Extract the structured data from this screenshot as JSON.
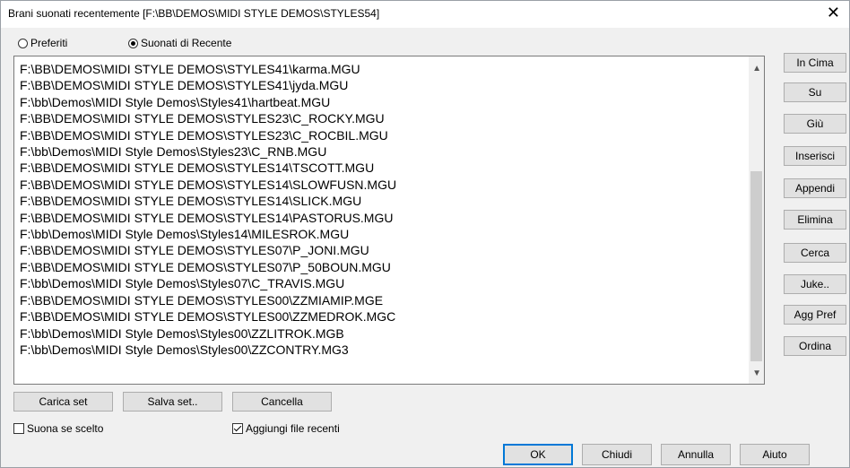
{
  "window": {
    "title": "Brani suonati recentemente   [F:\\BB\\DEMOS\\MIDI STYLE DEMOS\\STYLES54]",
    "close_glyph": "✕"
  },
  "radios": {
    "preferiti": "Preferiti",
    "suonati": "Suonati di Recente",
    "selected": "suonati"
  },
  "list": {
    "items": [
      "F:\\BB\\DEMOS\\MIDI STYLE DEMOS\\STYLES41\\karma.MGU",
      "F:\\BB\\DEMOS\\MIDI STYLE DEMOS\\STYLES41\\jyda.MGU",
      "F:\\bb\\Demos\\MIDI Style Demos\\Styles41\\hartbeat.MGU",
      "F:\\BB\\DEMOS\\MIDI STYLE DEMOS\\STYLES23\\C_ROCKY.MGU",
      "F:\\BB\\DEMOS\\MIDI STYLE DEMOS\\STYLES23\\C_ROCBIL.MGU",
      "F:\\bb\\Demos\\MIDI Style Demos\\Styles23\\C_RNB.MGU",
      "F:\\BB\\DEMOS\\MIDI STYLE DEMOS\\STYLES14\\TSCOTT.MGU",
      "F:\\BB\\DEMOS\\MIDI STYLE DEMOS\\STYLES14\\SLOWFUSN.MGU",
      "F:\\BB\\DEMOS\\MIDI STYLE DEMOS\\STYLES14\\SLICK.MGU",
      "F:\\BB\\DEMOS\\MIDI STYLE DEMOS\\STYLES14\\PASTORUS.MGU",
      "F:\\bb\\Demos\\MIDI Style Demos\\Styles14\\MILESROK.MGU",
      "F:\\BB\\DEMOS\\MIDI STYLE DEMOS\\STYLES07\\P_JONI.MGU",
      "F:\\BB\\DEMOS\\MIDI STYLE DEMOS\\STYLES07\\P_50BOUN.MGU",
      "F:\\bb\\Demos\\MIDI Style Demos\\Styles07\\C_TRAVIS.MGU",
      "F:\\BB\\DEMOS\\MIDI STYLE DEMOS\\STYLES00\\ZZMIAMIP.MGE",
      "F:\\BB\\DEMOS\\MIDI STYLE DEMOS\\STYLES00\\ZZMEDROK.MGC",
      "F:\\bb\\Demos\\MIDI Style Demos\\Styles00\\ZZLITROK.MGB",
      "F:\\bb\\Demos\\MIDI Style Demos\\Styles00\\ZZCONTRY.MG3"
    ]
  },
  "side_buttons": [
    "In Cima",
    "Su",
    "Giù",
    "Inserisci",
    "Appendi",
    "Elimina",
    "Cerca",
    "Juke..",
    "Agg Pref",
    "Ordina"
  ],
  "bottom_buttons": {
    "carica": "Carica set",
    "salva": "Salva set..",
    "cancella": "Cancella"
  },
  "checkboxes": {
    "suona": {
      "label": "Suona se scelto",
      "checked": false
    },
    "aggiungi": {
      "label": "Aggiungi file recenti",
      "checked": true
    }
  },
  "footer_buttons": {
    "ok": "OK",
    "chiudi": "Chiudi",
    "annulla": "Annulla",
    "aiuto": "Aiuto"
  },
  "colors": {
    "default_button_border": "#0078d7",
    "dialog_bg": "#f0f0f0"
  }
}
